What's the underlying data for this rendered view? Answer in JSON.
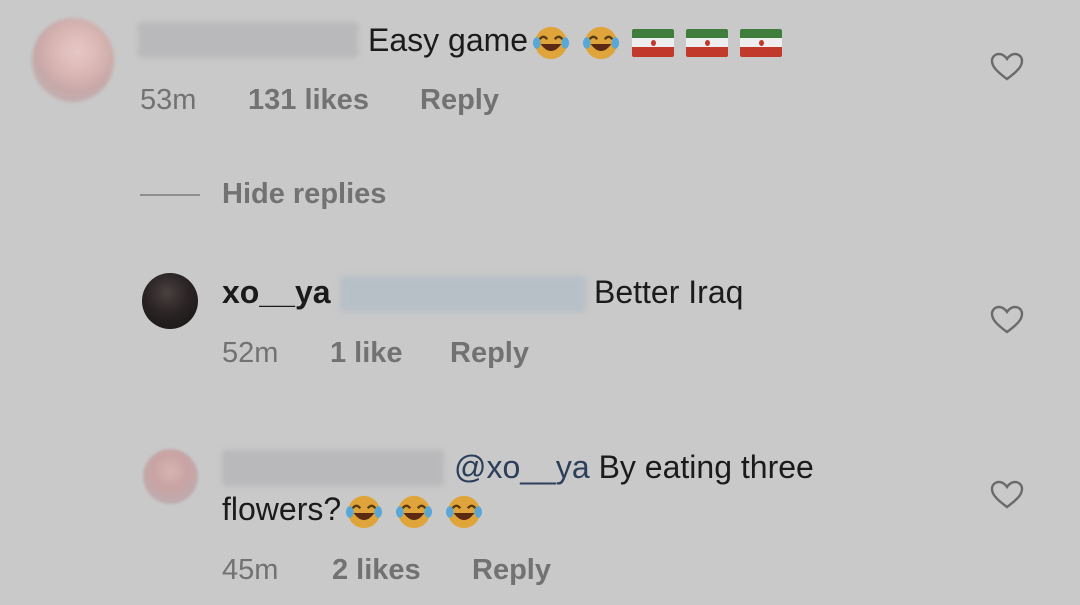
{
  "comments": [
    {
      "username": "",
      "text": "Easy game",
      "emojis": [
        "😂",
        "😂"
      ],
      "flags": [
        "🇮🇷",
        "🇮🇷",
        "🇮🇷"
      ],
      "time": "53m",
      "likes": "131 likes",
      "reply_label": "Reply"
    },
    {
      "username": "xo__ya",
      "mention": "",
      "text": "Better Iraq",
      "time": "52m",
      "likes": "1 like",
      "reply_label": "Reply"
    },
    {
      "username": "",
      "mention": "@xo__ya",
      "text_line1": "By eating three",
      "text_line2": "flowers?",
      "emojis": [
        "😂",
        "😂",
        "😂"
      ],
      "time": "45m",
      "likes": "2 likes",
      "reply_label": "Reply"
    }
  ],
  "hide_replies_label": "Hide replies",
  "colors": {
    "background": "#c9c9c9",
    "meta_text": "#727272",
    "mention": "#2c3f5a",
    "flag_green": "#3e7d3c",
    "flag_red": "#c0392b"
  }
}
